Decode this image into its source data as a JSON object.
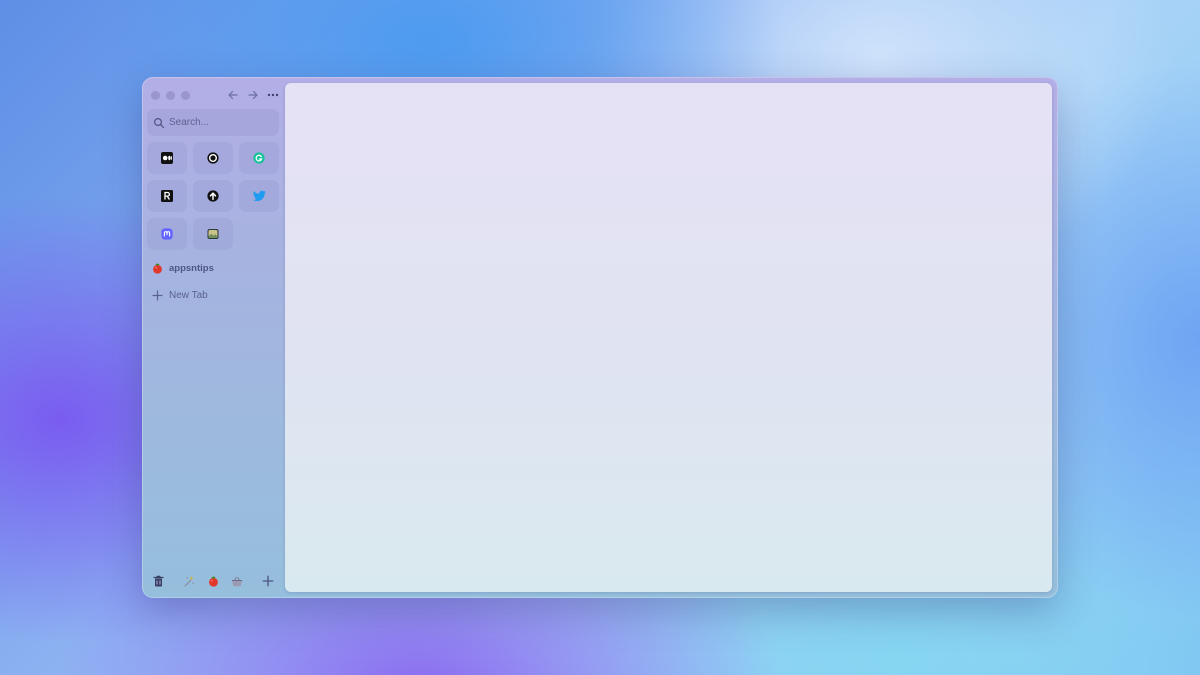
{
  "sidebar": {
    "search": {
      "placeholder": "Search..."
    },
    "favorites": [
      {
        "name": "medium",
        "icon": "medium-icon"
      },
      {
        "name": "circle",
        "icon": "circle-icon"
      },
      {
        "name": "grammarly",
        "icon": "grammarly-icon"
      },
      {
        "name": "readwise",
        "icon": "r-logo-icon"
      },
      {
        "name": "upload",
        "icon": "upload-arrow-icon"
      },
      {
        "name": "twitter",
        "icon": "twitter-bird-icon"
      },
      {
        "name": "mastodon",
        "icon": "mastodon-icon"
      },
      {
        "name": "photo",
        "icon": "landscape-photo-icon"
      }
    ],
    "tab": {
      "label": "appsntips",
      "icon": "tomato-icon"
    },
    "new_tab": {
      "label": "New Tab"
    },
    "spaces": [
      {
        "icon": "trash-icon"
      },
      {
        "icon": "sparkle-icon"
      },
      {
        "icon": "tomato-icon"
      },
      {
        "icon": "basket-icon"
      }
    ]
  },
  "colors": {
    "accent_purple": "#7a5cf0",
    "twitter_blue": "#1d9bf0",
    "grammarly_green": "#15c39a",
    "mastodon_purple": "#6364ff",
    "tomato_red": "#e0382b"
  }
}
